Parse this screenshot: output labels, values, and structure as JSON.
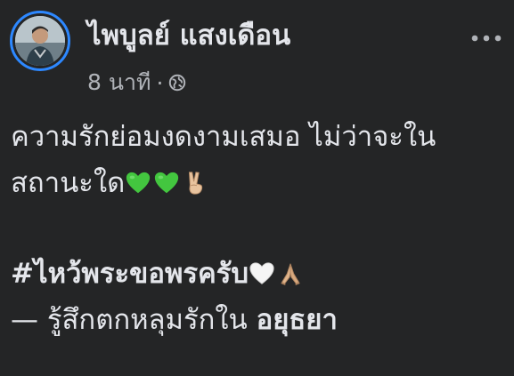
{
  "post": {
    "author_name": "ไพบูลย์ แสงเดือน",
    "timestamp": "8 นาที",
    "separator": "·",
    "privacy_icon": "globe-icon",
    "more_icon": "more-options-icon",
    "lines": {
      "line1": "ความรักย่อมงดงามเสมอ ไม่ว่าจะใน",
      "line2": "สถานะใด",
      "hashtag": "#ไหว้พระขอพรครับ",
      "feeling_prefix": "— รู้สึกตกหลุมรักใน ",
      "location": "อยุธยา"
    },
    "emojis": {
      "line2": [
        "green-heart",
        "green-heart",
        "victory-hand"
      ],
      "hashtag_line": [
        "white-heart",
        "folded-hands"
      ]
    },
    "colors": {
      "background": "#242526",
      "text_primary": "#e4e6eb",
      "text_secondary": "#b0b3b8",
      "story_ring": "#2d88ff",
      "green_heart": "#43c63f"
    }
  }
}
